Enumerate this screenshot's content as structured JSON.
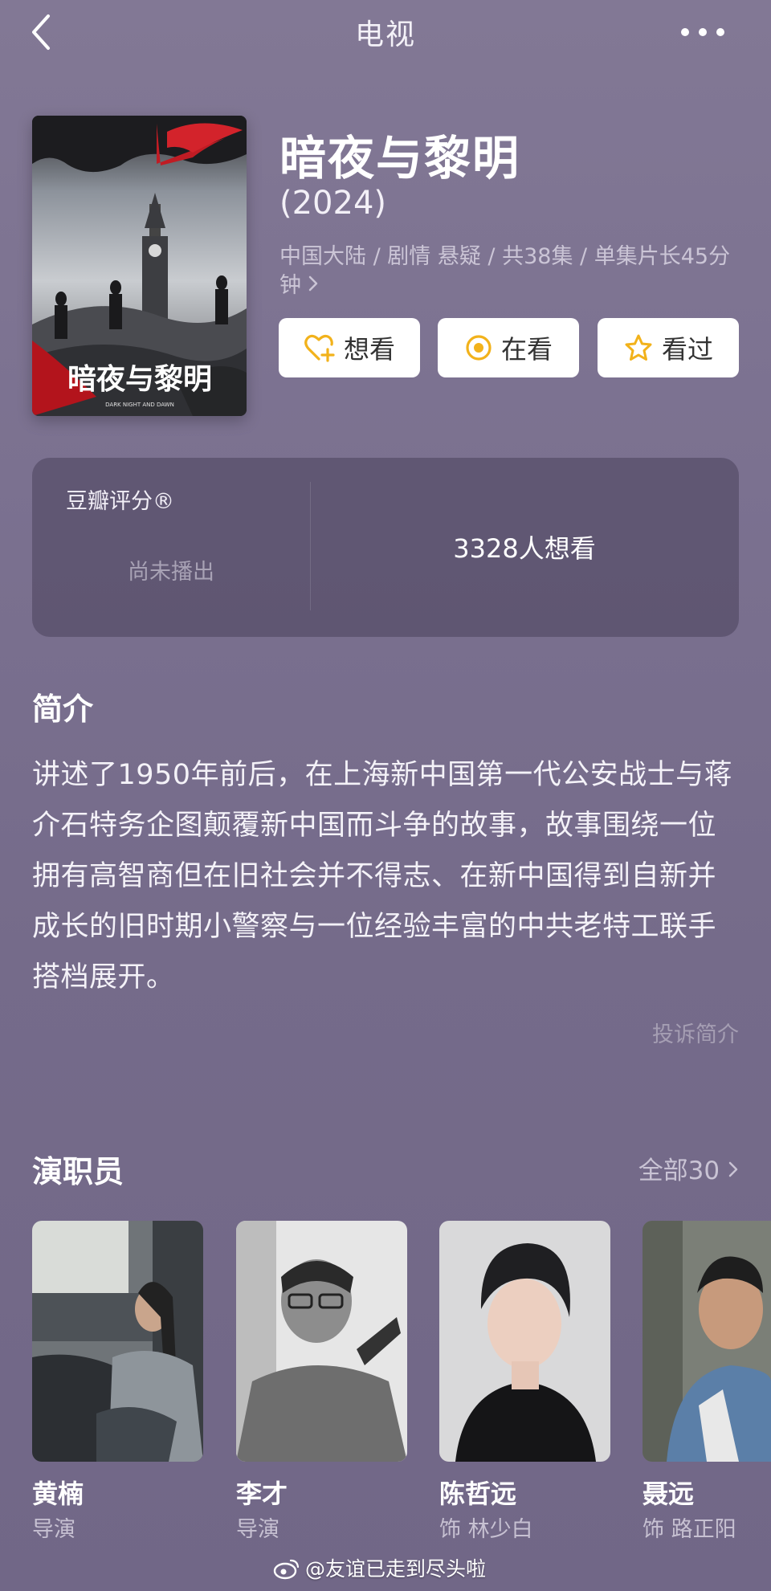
{
  "nav": {
    "title": "电视"
  },
  "movie": {
    "title": "暗夜与黎明",
    "year": "(2024)",
    "meta": "中国大陆 / 剧情 悬疑 / 共38集 / 单集片长45分钟",
    "poster_title": "暗夜与黎明",
    "poster_subtitle": "DARK NIGHT AND DAWN"
  },
  "actions": [
    {
      "label": "想看",
      "icon": "heart-plus-icon"
    },
    {
      "label": "在看",
      "icon": "target-circle-icon"
    },
    {
      "label": "看过",
      "icon": "star-icon"
    }
  ],
  "rating": {
    "label": "豆瓣评分®",
    "status": "尚未播出",
    "wish_count": "3328人想看"
  },
  "synopsis": {
    "heading": "简介",
    "text": "讲述了1950年前后，在上海新中国第一代公安战士与蒋介石特务企图颠覆新中国而斗争的故事，故事围绕一位拥有高智商但在旧社会并不得志、在新中国得到自新并成长的旧时期小警察与一位经验丰富的中共老特工联手搭档展开。",
    "report_label": "投诉简介"
  },
  "cast": {
    "heading": "演职员",
    "all_label": "全部30",
    "members": [
      {
        "name": "黄楠",
        "role": "导演"
      },
      {
        "name": "李才",
        "role": "导演"
      },
      {
        "name": "陈哲远",
        "role": "饰 林少白"
      },
      {
        "name": "聂远",
        "role": "饰 路正阳"
      }
    ]
  },
  "watermark": {
    "text": "@友谊已走到尽头啦"
  },
  "colors": {
    "background": "#7b7190",
    "accent_yellow": "#f2b21b",
    "card_bg": "#5a506e"
  }
}
